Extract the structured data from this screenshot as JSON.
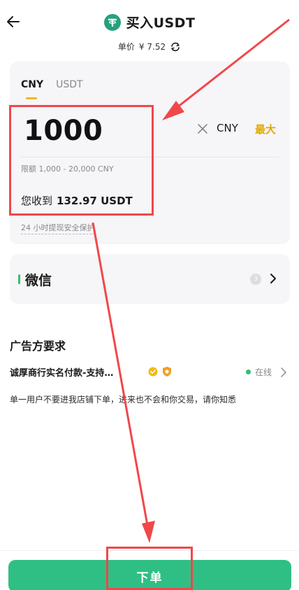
{
  "header": {
    "title": "买入USDT",
    "price_label": "单价",
    "price_value": "¥ 7.52"
  },
  "amount_card": {
    "tabs": [
      {
        "label": "CNY",
        "active": true
      },
      {
        "label": "USDT",
        "active": false
      }
    ],
    "amount_value": "1000",
    "currency": "CNY",
    "max_label": "最大",
    "limit_text": "限额 1,000 - 20,000 CNY",
    "receive_label": "您收到",
    "receive_value": "132.97 USDT",
    "safety_text": "24 小时提现安全保护"
  },
  "payment": {
    "method": "微信",
    "count": "3"
  },
  "advertiser": {
    "section_title": "广告方要求",
    "merchant_name": "诚厚商行实名付款-支持…",
    "status": "在线",
    "note": "单一用户不要进我店铺下单，进来也不会和你交易，请你知悉"
  },
  "action": {
    "order_label": "下单"
  },
  "colors": {
    "accent_green": "#2fbf85",
    "tether_green": "#26a17b",
    "max_yellow": "#e2a900",
    "annotation_red": "#f1474b"
  }
}
